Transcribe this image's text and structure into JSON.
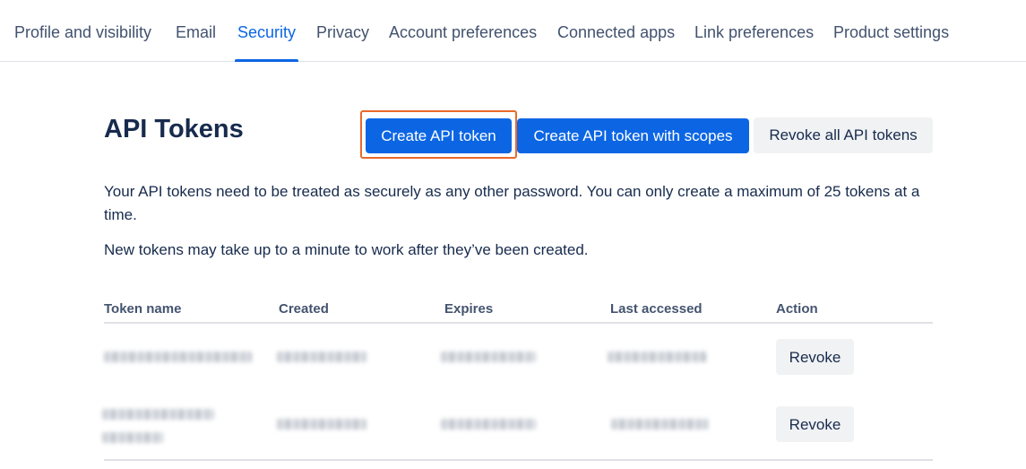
{
  "nav": {
    "tabs": [
      {
        "label": "Profile and visibility"
      },
      {
        "label": "Email"
      },
      {
        "label": "Security",
        "active": true
      },
      {
        "label": "Privacy"
      },
      {
        "label": "Account preferences"
      },
      {
        "label": "Connected apps"
      },
      {
        "label": "Link preferences"
      },
      {
        "label": "Product settings"
      }
    ]
  },
  "page": {
    "title": "API Tokens",
    "buttons": {
      "create": "Create API token",
      "create_scoped": "Create API token with scopes",
      "revoke_all": "Revoke all API tokens"
    },
    "description": "Your API tokens need to be treated as securely as any other password. You can only create a maximum of 25 tokens at a time.",
    "note": "New tokens may take up to a minute to work after they’ve been created."
  },
  "table": {
    "headers": [
      "Token name",
      "Created",
      "Expires",
      "Last accessed",
      "Action"
    ],
    "rows": [
      {
        "action": "Revoke"
      },
      {
        "action": "Revoke"
      }
    ]
  },
  "colors": {
    "primary": "#0c66e4",
    "highlight": "#e9692c",
    "text": "#172b4d"
  }
}
